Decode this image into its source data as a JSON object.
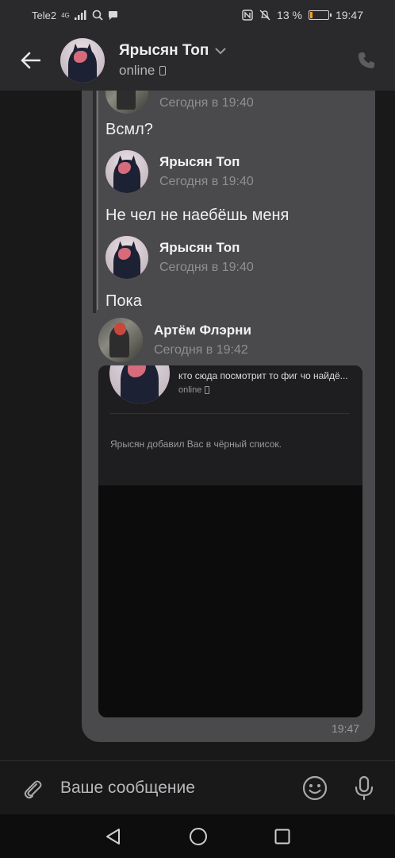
{
  "status_bar": {
    "carrier": "Tele2",
    "network": "4G",
    "battery_text": "13 %",
    "battery_level": 0.13,
    "time": "19:47"
  },
  "header": {
    "title": "Ярысян Топ",
    "status": "online"
  },
  "messages": [
    {
      "author": "",
      "time": "Сегодня в 19:40",
      "text": "Всмл?"
    },
    {
      "author": "Ярысян Топ",
      "time": "Сегодня в 19:40",
      "text": "Не чел не наебёшь меня"
    },
    {
      "author": "Ярысян Топ",
      "time": "Сегодня в 19:40",
      "text": "Пока"
    },
    {
      "author": "Артём Флэрни",
      "time": "Сегодня в 19:42",
      "text": ""
    }
  ],
  "attachment": {
    "title": "кто сюда посмотрит то фиг чо найдё...",
    "status": "online",
    "note": "Ярысян добавил Вас в чёрный список."
  },
  "bubble_time": "19:47",
  "composer": {
    "placeholder": "Ваше сообщение"
  },
  "colors": {
    "background": "#19191a",
    "header": "#2a2a2c",
    "bubble": "#4a4a4c",
    "battery_low": "#f0a020"
  },
  "icons": [
    "back-arrow-icon",
    "chevron-down-icon",
    "phone-icon",
    "paperclip-icon",
    "emoji-icon",
    "microphone-icon",
    "nav-back-icon",
    "nav-home-icon",
    "nav-recents-icon"
  ]
}
